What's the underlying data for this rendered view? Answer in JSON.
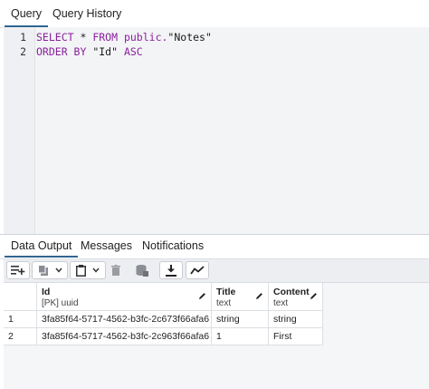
{
  "top_tabs": [
    "Query",
    "Query History"
  ],
  "editor": {
    "line_numbers": [
      "1",
      "2"
    ],
    "line1": {
      "kw1": "SELECT",
      "star": " * ",
      "kw2": "FROM",
      "schema": " public.",
      "table": "\"Notes\""
    },
    "line2": {
      "kw1": "ORDER BY",
      "col": " \"Id\" ",
      "kw2": "ASC"
    }
  },
  "result_tabs": [
    "Data Output",
    "Messages",
    "Notifications"
  ],
  "toolbar_icons": [
    "add-row-icon",
    "copy-icon",
    "dropdown-icon",
    "paste-icon",
    "dropdown-icon",
    "delete-icon",
    "save-data-icon",
    "download-icon",
    "graph-icon"
  ],
  "grid": {
    "columns": [
      {
        "name": "Id",
        "type": "[PK] uuid"
      },
      {
        "name": "Title",
        "type": "text"
      },
      {
        "name": "Content",
        "type": "text"
      }
    ],
    "rows": [
      {
        "num": "1",
        "cells": [
          "3fa85f64-5717-4562-b3fc-2c673f66afa6",
          "string",
          "string"
        ]
      },
      {
        "num": "2",
        "cells": [
          "3fa85f64-5717-4562-b3fc-2c963f66afa6",
          "1",
          "First"
        ]
      }
    ]
  },
  "colors": {
    "accent": "#326690",
    "keyword": "#8a1f9c"
  }
}
